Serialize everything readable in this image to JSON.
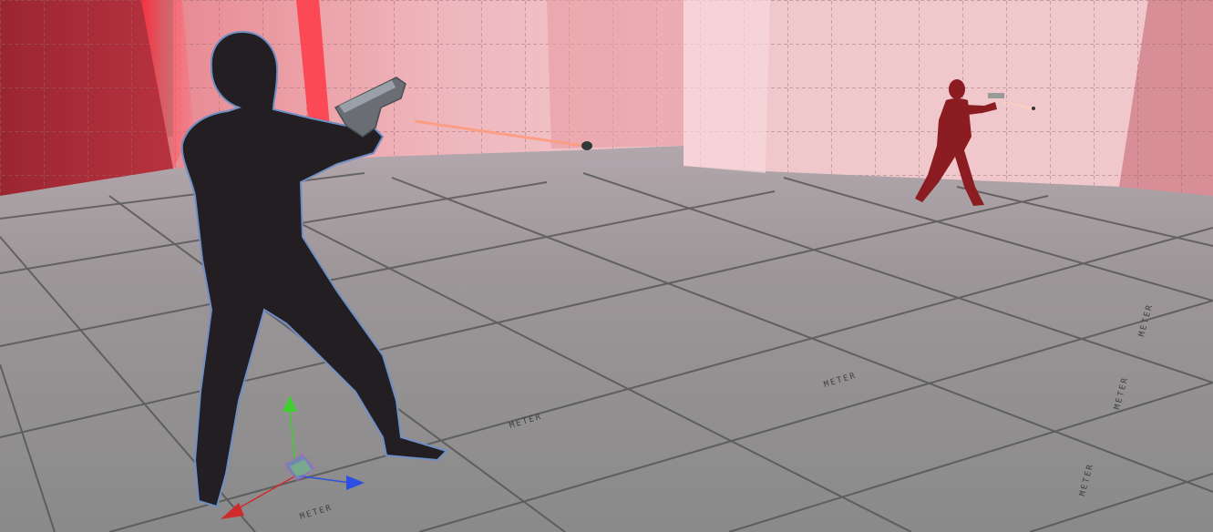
{
  "scene": {
    "environment": "grid-tiled room with red translucent walls and gray floor",
    "colors": {
      "floor": "#8a8a8a",
      "floor_far": "#a89fa3",
      "grid_line": "#4a4a4a",
      "wall_red": "#d85a68",
      "wall_pink": "#ecbcc2",
      "wall_dark_red": "#a8323e",
      "player": "#231e22",
      "player_outline": "#6f8fc4",
      "enemy": "#8a1c22",
      "bullet_trail": "#ff9a7a",
      "gizmo_x": "#d12a2a",
      "gizmo_y": "#3fcf2f",
      "gizmo_z": "#2b4fe0"
    },
    "floor_labels": [
      "METER",
      "METER",
      "METER",
      "METER",
      "METER",
      "METER"
    ],
    "player": {
      "state": "selected",
      "holding": "pistol",
      "icon": "player-silhouette"
    },
    "enemy": {
      "holding": "pistol",
      "icon": "enemy-silhouette"
    },
    "gizmo": {
      "type": "move",
      "axes": [
        "x",
        "y",
        "z"
      ]
    }
  }
}
